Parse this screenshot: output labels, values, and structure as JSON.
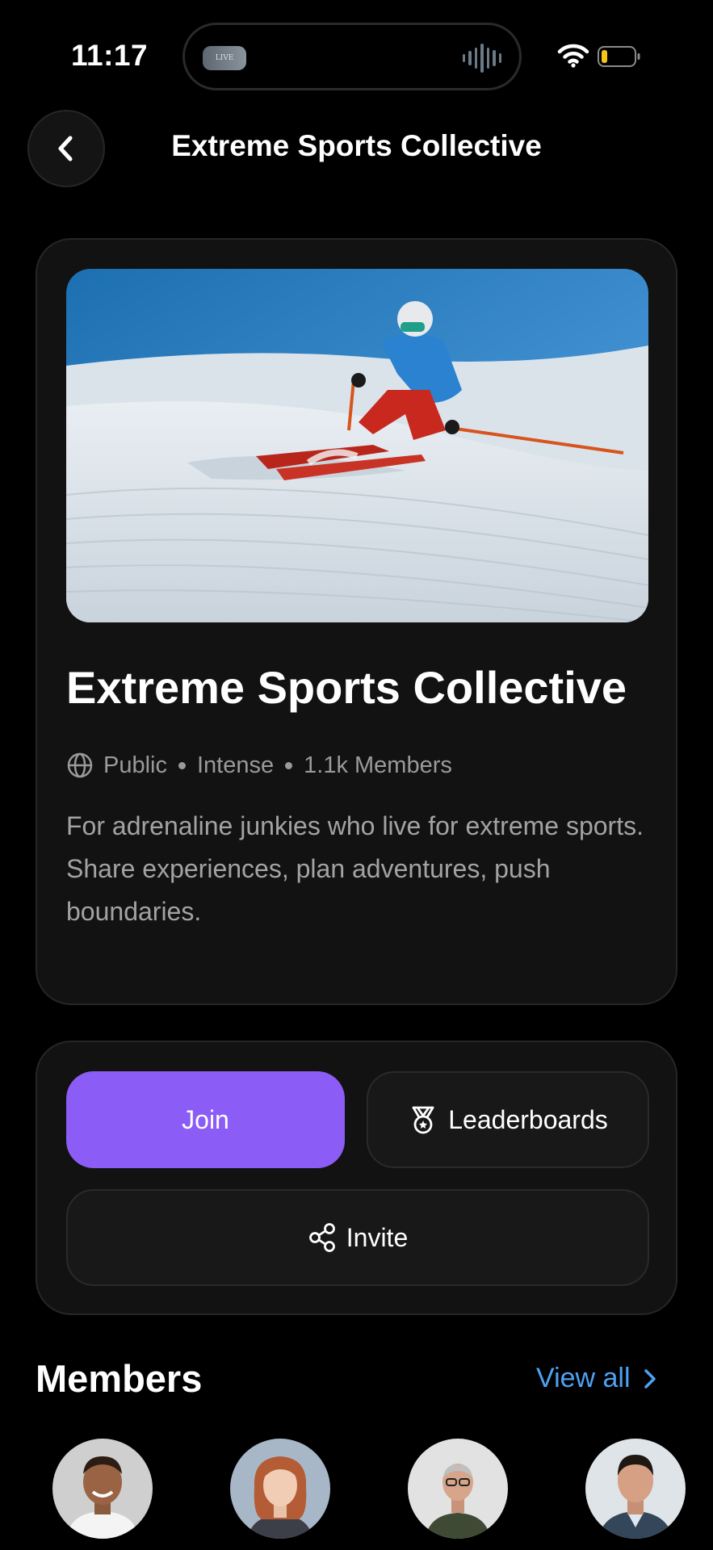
{
  "status_bar": {
    "time": "11:17",
    "island_thumb_text": "LIVE",
    "battery_color": "#f5c518"
  },
  "header": {
    "title": "Extreme Sports Collective",
    "back_icon": "chevron-left-icon"
  },
  "group": {
    "name": "Extreme Sports Collective",
    "visibility": "Public",
    "intensity": "Intense",
    "members_count": "1.1k Members",
    "description": "For adrenaline junkies who live for extreme sports. Share experiences, plan adventures, push boundaries.",
    "hero_image": "skier-on-snow-slope",
    "visibility_icon": "globe-icon"
  },
  "actions": {
    "join_label": "Join",
    "leaderboards_label": "Leaderboards",
    "leaderboards_icon": "medal-icon",
    "invite_label": "Invite",
    "invite_icon": "share-icon",
    "accent_color": "#8b5cf6"
  },
  "members": {
    "title": "Members",
    "view_all_label": "View all",
    "link_color": "#4ea1f3",
    "avatars": [
      "member-avatar-1",
      "member-avatar-2",
      "member-avatar-3",
      "member-avatar-4"
    ]
  }
}
